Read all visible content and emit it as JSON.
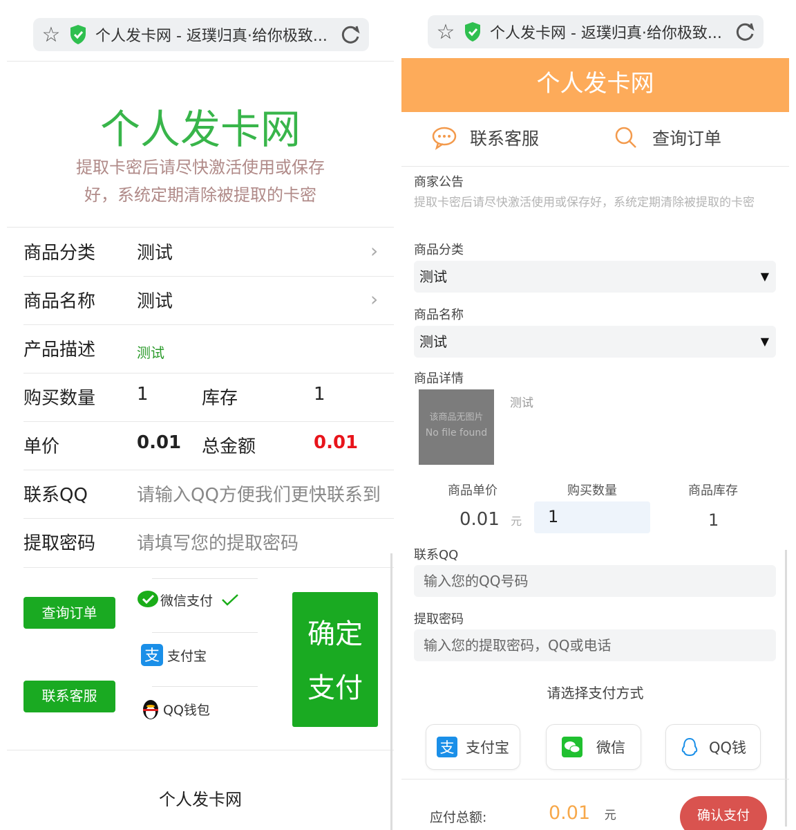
{
  "left": {
    "browser_title": "个人发卡网 - 返璞归真·给你极致...",
    "site_title": "个人发卡网",
    "notice_line1": "提取卡密后请尽快激活使用或保存",
    "notice_line2": "好，系统定期清除被提取的卡密",
    "rows": {
      "category_label": "商品分类",
      "category_value": "测试",
      "name_label": "商品名称",
      "name_value": "测试",
      "desc_label": "产品描述",
      "desc_value": "测试",
      "qty_label": "购买数量",
      "qty_value": "1",
      "stock_label": "库存",
      "stock_value": "1",
      "price_label": "单价",
      "price_value": "0.01",
      "total_label": "总金额",
      "total_value": "0.01",
      "qq_label": "联系QQ",
      "qq_placeholder": "请输入QQ方便我们更快联系到",
      "pwd_label": "提取密码",
      "pwd_placeholder": "请填写您的提取密码"
    },
    "query_order_btn": "查询订单",
    "contact_service_btn": "联系客服",
    "pay_wechat": "微信支付",
    "pay_alipay": "支付宝",
    "pay_qq": "QQ钱包",
    "confirm_line1": "确定",
    "confirm_line2": "支付",
    "footer": "个人发卡网"
  },
  "right": {
    "browser_title": "个人发卡网 - 返璞归真·给你极致...",
    "header_title": "个人发卡网",
    "nav_contact": "联系客服",
    "nav_query": "查询订单",
    "announce_label": "商家公告",
    "announce_text": "提取卡密后请尽快激活使用或保存好，系统定期清除被提取的卡密",
    "category_label": "商品分类",
    "category_value": "测试",
    "name_label": "商品名称",
    "name_value": "测试",
    "detail_label": "商品详情",
    "no_image_line1": "该商品无图片",
    "no_image_line2": "No file found",
    "detail_text": "测试",
    "unit_price_label": "商品单价",
    "qty_label": "购买数量",
    "stock_label": "商品库存",
    "unit_price_value": "0.01",
    "yuan": "元",
    "qty_value": "1",
    "stock_value": "1",
    "qq_label": "联系QQ",
    "qq_placeholder": "输入您的QQ号码",
    "pwd_label": "提取密码",
    "pwd_placeholder": "输入您的提取密码，QQ或电话",
    "pay_method_prompt": "请选择支付方式",
    "pay_alipay": "支付宝",
    "pay_wechat": "微信",
    "pay_qq": "QQ钱",
    "total_label": "应付总额:",
    "total_value": "0.01",
    "total_unit": "元",
    "confirm_pay": "确认支付"
  },
  "colors": {
    "green_title": "#38b54a",
    "green_button": "#1aaa22",
    "orange_header": "#fdab5a",
    "price_red": "#e8141b",
    "total_orange": "#f7a84a",
    "confirm_red": "#d9534f"
  },
  "icons": [
    "star-icon",
    "shield-icon",
    "reload-icon",
    "chevron-right-icon",
    "wechat-icon",
    "check-icon",
    "alipay-icon",
    "qq-penguin-icon",
    "chat-icon",
    "search-icon",
    "dropdown-arrow-icon"
  ]
}
